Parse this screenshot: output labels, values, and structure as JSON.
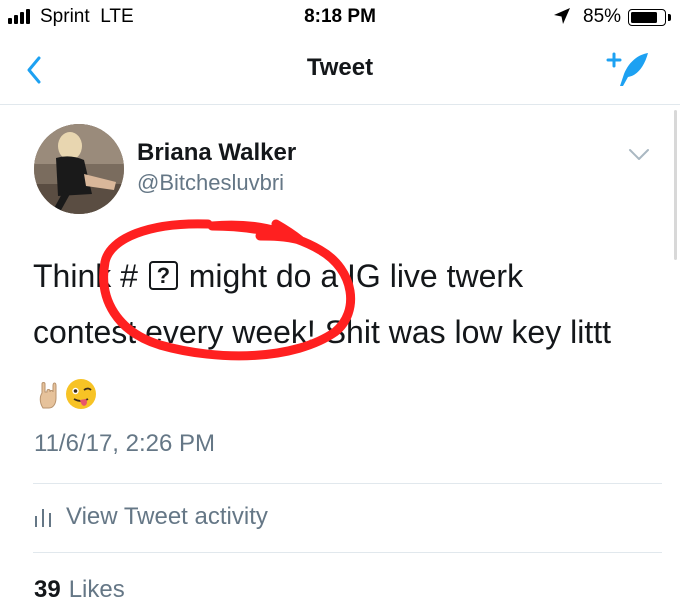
{
  "status_bar": {
    "carrier": "Sprint",
    "network": "LTE",
    "time": "8:18 PM",
    "battery_percent": "85%",
    "battery_level": 0.85,
    "location_icon": "location-arrow-icon",
    "signal_icon": "cellular-signal-icon"
  },
  "nav": {
    "title": "Tweet",
    "back_icon": "chevron-left-icon",
    "compose_icon": "compose-tweet-icon"
  },
  "tweet": {
    "author_name": "Briana Walker",
    "handle": "@Bitchesluvbri",
    "text_part1": "Think # ",
    "unknown_glyph": "?",
    "text_part2": " might do a IG live twerk contest every week! Shit was low key littt ",
    "emojis": [
      "rock-on-hand-emoji",
      "winking-tongue-face-emoji"
    ],
    "timestamp": "11/6/17, 2:26 PM",
    "activity_label": "View Tweet activity",
    "likes_count": "39",
    "likes_label": "Likes"
  },
  "colors": {
    "accent": "#1da1f2",
    "secondary_text": "#657786",
    "primary_text": "#14171a",
    "annotation_red": "#ff2020"
  }
}
